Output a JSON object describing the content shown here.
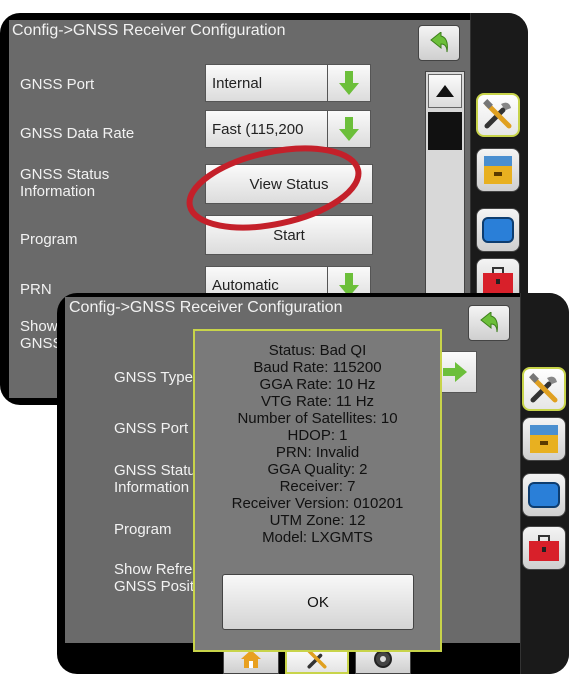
{
  "back_panel": {
    "title": "Config->GNSS Receiver Configuration",
    "rows": [
      {
        "label": "GNSS Port",
        "value": "Internal",
        "control": "dropdown"
      },
      {
        "label": "GNSS Data Rate",
        "value": "Fast (115,200",
        "control": "dropdown"
      },
      {
        "label": "GNSS Status Information",
        "value": "View Status",
        "control": "button"
      },
      {
        "label": "Program",
        "value": "Start",
        "control": "button"
      },
      {
        "label": "PRN",
        "value": "Automatic",
        "control": "dropdown"
      },
      {
        "label": "Show GNSS",
        "value": "",
        "control": "none"
      }
    ]
  },
  "front_panel": {
    "title": "Config->GNSS Receiver Configuration",
    "rows": [
      {
        "label": "GNSS Type"
      },
      {
        "label": "GNSS Port"
      },
      {
        "label": "GNSS Status Information"
      },
      {
        "label": "Program"
      },
      {
        "label": "Show Refresh GNSS Position"
      }
    ]
  },
  "status_modal": {
    "lines": [
      "Status: Bad QI",
      "Baud Rate: 115200",
      "GGA Rate: 10 Hz",
      "VTG Rate: 11 Hz",
      "Number of Satellites: 10",
      "HDOP: 1",
      "PRN: Invalid",
      "GGA Quality: 2",
      "Receiver: 7",
      "Receiver Version: 010201",
      "UTM Zone: 12",
      "Model: LXGMTS"
    ],
    "ok_label": "OK"
  },
  "sidebar_icons": [
    "tools-icon",
    "storage-cabinet-icon",
    "display-icon",
    "toolbox-icon"
  ],
  "bottom_nav": [
    "home-icon",
    "tools-icon",
    "gauge-icon"
  ],
  "colors": {
    "accent": "#c8d44a",
    "highlight_ellipse": "#c4202a",
    "arrow_green": "#6cbf3a",
    "screen_bg": "#6a6a6a"
  }
}
